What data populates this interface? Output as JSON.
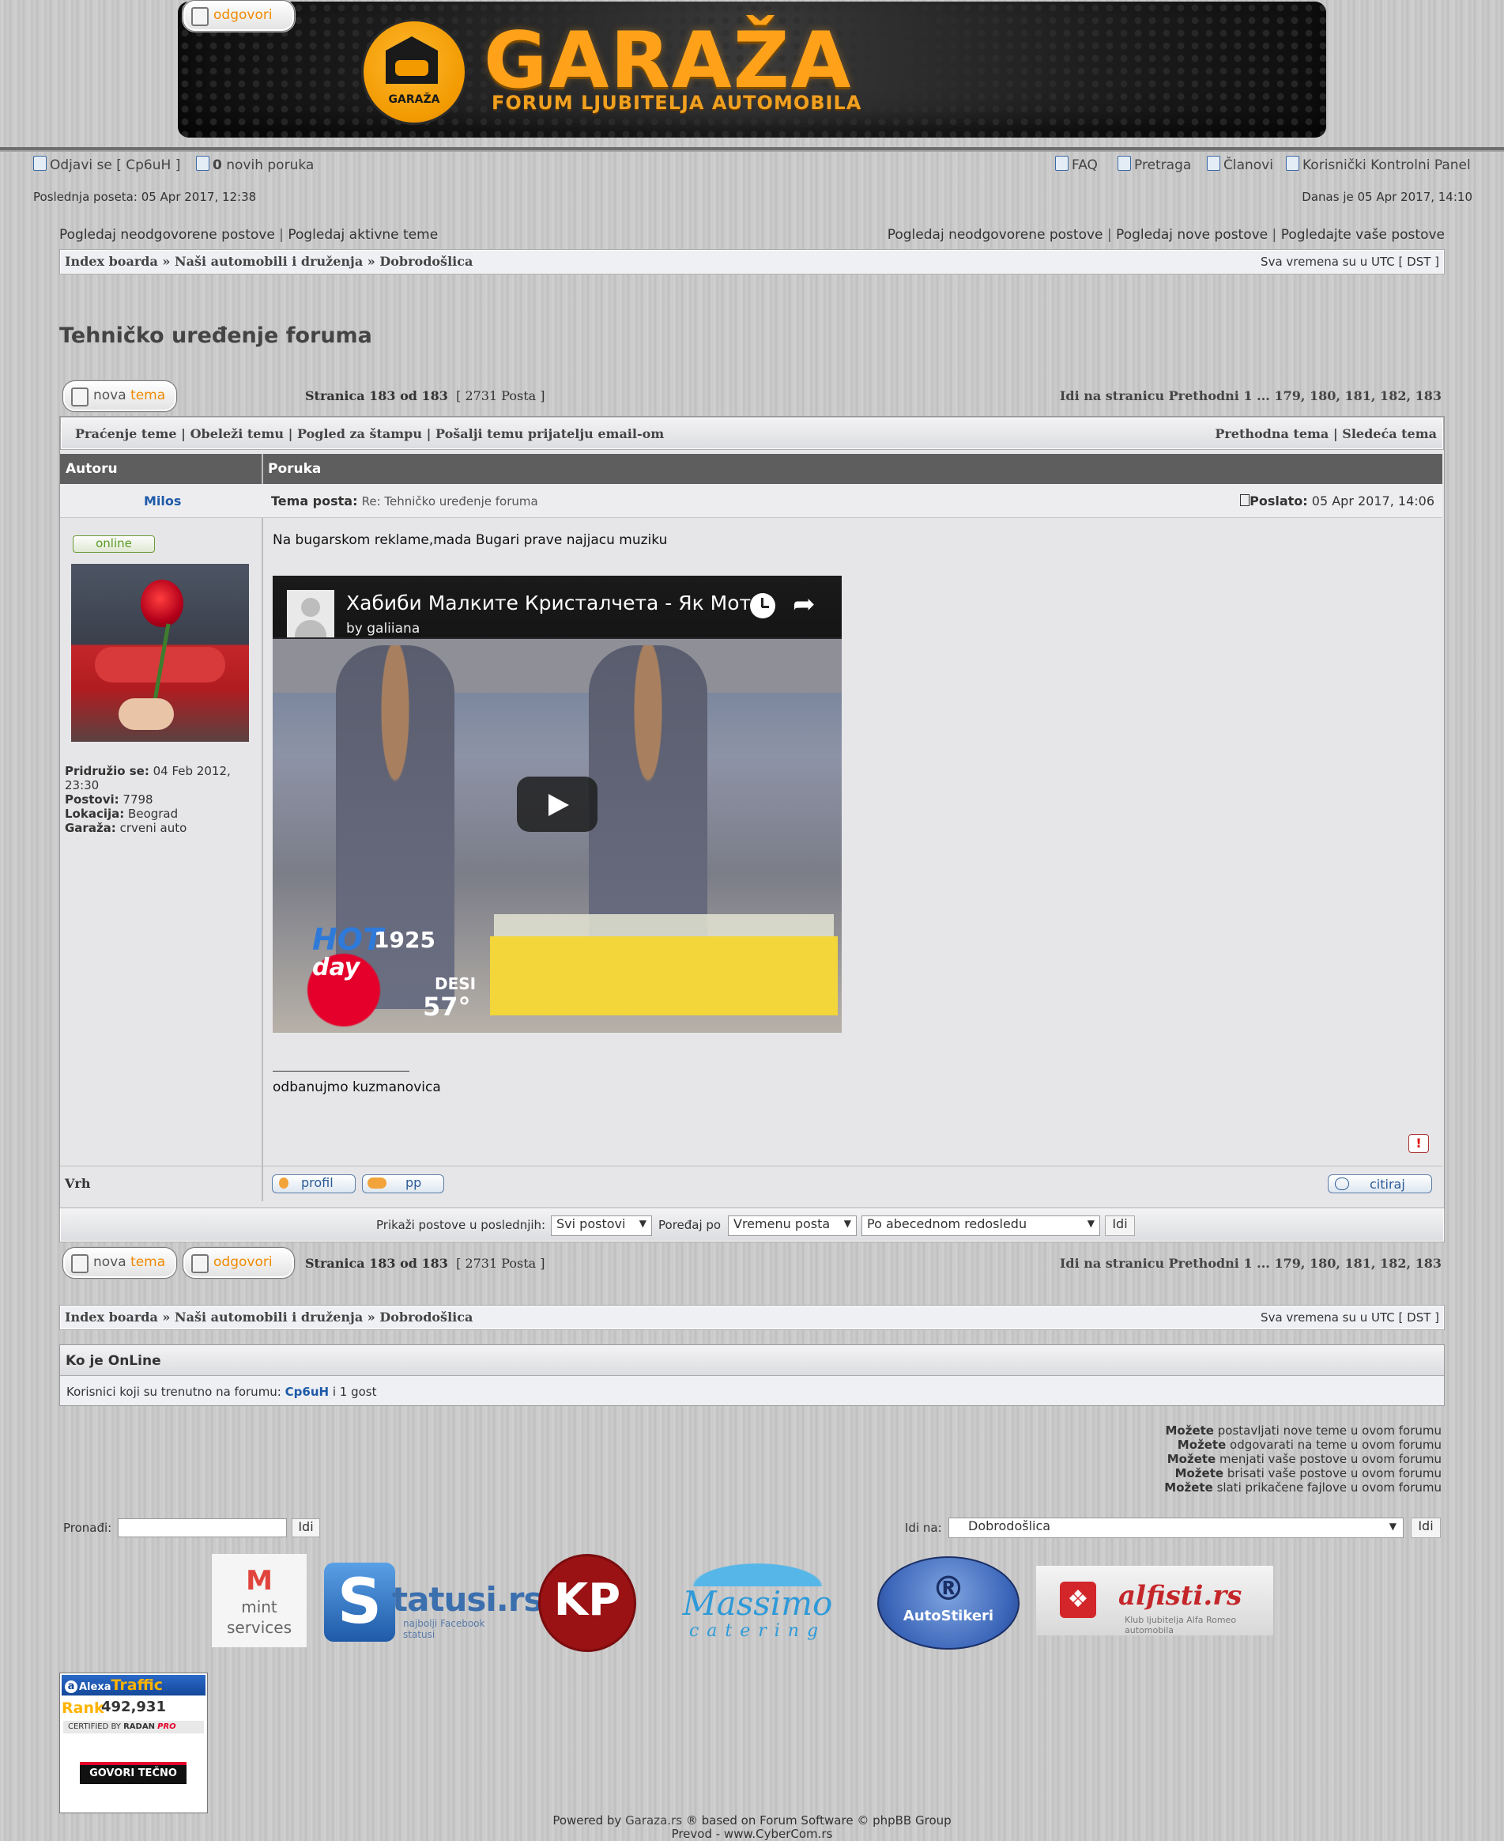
{
  "banner": {
    "logo_text": "GARAŽA",
    "brand": "GARAŽA",
    "tagline": "FORUM LJUBITELJA AUTOMOBILA"
  },
  "topbar": {
    "logout_label": "Odjavi se [ Cp6uH ]",
    "new_messages_count": "0",
    "new_messages_label": "novih poruka",
    "faq": "FAQ",
    "search": "Pretraga",
    "members": "Članovi",
    "ucp": "Korisnički Kontrolni Panel",
    "last_post": "Poslednja poseta: 05 Apr 2017, 12:38",
    "today": "Danas je 05 Apr 2017, 14:10"
  },
  "search_links_left": [
    "Pogledaj neodgovorene postove",
    "Pogledaj aktivne teme"
  ],
  "search_links_right": [
    "Pogledaj neodgovorene postove",
    "Pogledaj nove postove",
    "Pogledajte vaše postove"
  ],
  "breadcrumb": {
    "items": [
      "Index boarda",
      "Naši automobili i druženja",
      "Dobrodošlica"
    ],
    "timezone": "Sva vremena su u UTC [ DST ]"
  },
  "topic_title": "Tehničko uređenje foruma",
  "buttons": {
    "new_topic_a": "nova",
    "new_topic_b": "tema",
    "reply": "odgovori"
  },
  "pagination": {
    "pages": "Stranica 183 od 183",
    "posts": "[ 2731 Posta ]",
    "goto": "Idi na stranicu Prethodni  1 ... 179, 180, 181, 182, 183"
  },
  "topic_tools_left": [
    "Praćenje teme",
    "Obeleži temu",
    "Pogled za štampu",
    "Pošalji temu prijatelju email-om"
  ],
  "topic_tools_right": [
    "Prethodna tema",
    "Sledeća tema"
  ],
  "table_headers": {
    "author": "Autoru",
    "message": "Poruka"
  },
  "post": {
    "author": "Milos",
    "status": "online",
    "subject_label": "Tema posta:",
    "subject": "Re: Tehničko uređenje foruma",
    "posted_label": "Poslato:",
    "posted": "05 Apr 2017, 14:06",
    "joined_label": "Pridružio se:",
    "joined": "04 Feb 2012, 23:30",
    "posts_label": "Postovi:",
    "posts": "7798",
    "location_label": "Lokacija:",
    "location": "Beograd",
    "garage_label": "Garaža:",
    "garage": "crveni auto",
    "body": "Na bugarskom reklame,mada Bugari prave najjacu muziku",
    "signature": "odbanujmo kuzmanovica",
    "video": {
      "title": "Хабиби Малките Кристалчета - Як Мот..",
      "channel": "by galiiana",
      "overlay_hot": "HOT",
      "overlay_num": "1925",
      "overlay_day": "day",
      "overlay_name": "DESI",
      "overlay_temp": "57°"
    },
    "top": "Vrh",
    "profile": "profil",
    "pm": "pp",
    "quote": "citiraj"
  },
  "filter": {
    "show_label": "Prikaži postove u poslednjih:",
    "show_value": "Svi postovi",
    "sort_label": "Poređaj po",
    "sort_value": "Vremenu posta",
    "order_value": "Po abecednom redosledu",
    "go": "Idi"
  },
  "online": {
    "title": "Ko je OnLine",
    "text": "Korisnici koji su trenutno na forumu:",
    "user": "Cp6uH",
    "guests": "i 1 gost"
  },
  "permissions": [
    {
      "bold": "Možete",
      "rest": "postavljati nove teme u ovom forumu"
    },
    {
      "bold": "Možete",
      "rest": "odgovarati na teme u ovom forumu"
    },
    {
      "bold": "Možete",
      "rest": "menjati vaše postove u ovom forumu"
    },
    {
      "bold": "Možete",
      "rest": "brisati vaše postove u ovom forumu"
    },
    {
      "bold": "Možete",
      "rest": "slati prikačene fajlove u ovom forumu"
    }
  ],
  "find": {
    "label": "Pronađi:",
    "value": "",
    "go": "Idi"
  },
  "jump": {
    "label": "Idi na:",
    "value": "Dobrodošlica",
    "go": "Idi"
  },
  "sponsors": {
    "mint_a": "mint",
    "mint_b": "services",
    "statusi": "tatusi.rs",
    "statusi_s": "S",
    "statusi_sub": "najbolji Facebook statusi",
    "kp": "KP",
    "massimo": "Massimo",
    "massimo_sub": "catering",
    "autostikeri": "AutoStikeri",
    "alfisti": "alfisti.rs",
    "alfisti_sub": "Klub ljubitelja Alfa Romeo automobila"
  },
  "alexa": {
    "brand": "Alexa",
    "title": "Traffic Rank",
    "rank": "492,931",
    "certified": "CERTIFIED BY",
    "radan": "RADAN",
    "pro": "PRO",
    "govori": "GOVORI TEČNO"
  },
  "footer": {
    "powered_prefix": "Powered by",
    "site": "Garaza.rs",
    "powered_rest": "® based on Forum Software © phpBB Group",
    "prevod": "Prevod - www.CyberCom.rs"
  },
  "colors": {
    "accent": "#f29a00",
    "link": "#1e5aa8",
    "header": "#5e5e5e"
  }
}
